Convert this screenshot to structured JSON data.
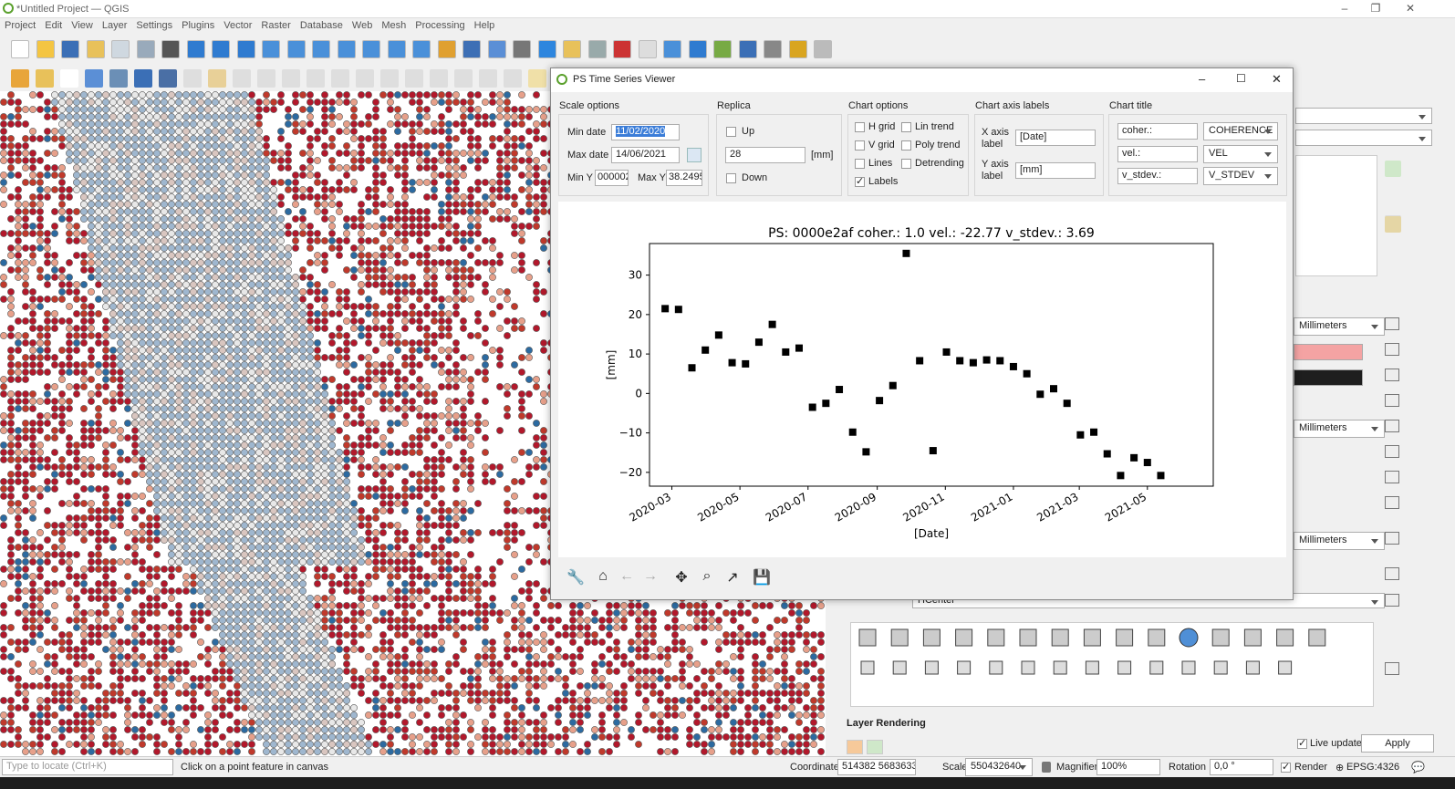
{
  "app": {
    "title": "*Untitled Project — QGIS"
  },
  "menu": [
    "Project",
    "Edit",
    "View",
    "Layer",
    "Settings",
    "Plugins",
    "Vector",
    "Raster",
    "Database",
    "Web",
    "Mesh",
    "Processing",
    "Help"
  ],
  "dialog": {
    "title": "PS Time Series Viewer",
    "scale_options": {
      "label": "Scale options",
      "min_date_label": "Min date",
      "min_date": "11/02/2020",
      "max_date_label": "Max date",
      "max_date": "14/06/2021",
      "min_y_label": "Min Y",
      "min_y": "000002",
      "max_y_label": "Max Y",
      "max_y": "38.2495"
    },
    "replica": {
      "label": "Replica",
      "up": "Up",
      "value": "28",
      "unit": "[mm]",
      "down": "Down"
    },
    "chart_options": {
      "label": "Chart options",
      "hgrid": "H grid",
      "vgrid": "V grid",
      "lines": "Lines",
      "labels": "Labels",
      "lin_trend": "Lin trend",
      "poly_trend": "Poly trend",
      "detrending": "Detrending"
    },
    "axis_labels": {
      "label": "Chart axis labels",
      "x_label": "X axis label",
      "x_value": "[Date]",
      "y_label": "Y axis label",
      "y_value": "[mm]"
    },
    "chart_title": {
      "label": "Chart title",
      "rows": [
        {
          "prefix": "coher.:",
          "field": "COHERENCE"
        },
        {
          "prefix": "vel.:",
          "field": "VEL"
        },
        {
          "prefix": "v_stdev.:",
          "field": "V_STDEV"
        }
      ]
    }
  },
  "chart_data": {
    "type": "scatter",
    "title": "PS: 0000e2af coher.: 1.0 vel.: -22.77 v_stdev.: 3.69",
    "xlabel": "[Date]",
    "ylabel": "[mm]",
    "xlim": [
      "2020-02-10",
      "2021-06-29"
    ],
    "ylim": [
      -23.5,
      38
    ],
    "xticks": [
      "2020-03",
      "2020-05",
      "2020-07",
      "2020-09",
      "2020-11",
      "2021-01",
      "2021-03",
      "2021-05"
    ],
    "yticks": [
      -20,
      -10,
      0,
      10,
      20,
      30
    ],
    "x": [
      "2020-02-24",
      "2020-03-07",
      "2020-03-19",
      "2020-03-31",
      "2020-04-12",
      "2020-04-24",
      "2020-05-06",
      "2020-05-18",
      "2020-05-30",
      "2020-06-11",
      "2020-06-23",
      "2020-07-05",
      "2020-07-17",
      "2020-07-29",
      "2020-08-10",
      "2020-08-22",
      "2020-09-03",
      "2020-09-15",
      "2020-09-27",
      "2020-10-09",
      "2020-10-21",
      "2020-11-02",
      "2020-11-14",
      "2020-11-26",
      "2020-12-08",
      "2020-12-20",
      "2021-01-01",
      "2021-01-13",
      "2021-01-25",
      "2021-02-06",
      "2021-02-18",
      "2021-03-02",
      "2021-03-14",
      "2021-03-26",
      "2021-04-07",
      "2021-04-19",
      "2021-05-01",
      "2021-05-13",
      "2021-05-25",
      "2021-06-06"
    ],
    "y": [
      21.5,
      21.3,
      6.5,
      11,
      14.8,
      7.8,
      7.5,
      13,
      17.5,
      10.5,
      11.5,
      -3.5,
      -2.5,
      1,
      -9.8,
      -14.8,
      -1.8,
      2,
      35.5,
      8.3,
      -14.5,
      10.5,
      8.3,
      7.8,
      8.5,
      8.3,
      6.8,
      5,
      -0.2,
      1.2,
      -2.5,
      -10.5,
      -9.8,
      -15.3,
      -20.8,
      -16.3,
      -17.5,
      -20.8
    ]
  },
  "map": {
    "colors": {
      "dark_red": "#b2182b",
      "mid_red": "#c0392b",
      "salmon": "#e7a08a",
      "light": "#d9c6c0",
      "grey_blue": "#9fb7cf",
      "blue": "#2c6aa0",
      "pale": "#e8e8e8"
    }
  },
  "right_panel": {
    "units": [
      "Millimeters",
      "Millimeters",
      "Millimeters"
    ],
    "hcenter": "HCenter",
    "layer_rendering": "Layer Rendering",
    "live_update": "Live update",
    "apply": "Apply"
  },
  "status": {
    "locate_placeholder": "Type to locate (Ctrl+K)",
    "message": "Click on a point feature in canvas",
    "coordinate_label": "Coordinate",
    "coordinate": "514382 5683633",
    "scale_label": "Scale",
    "scale": "550432640",
    "magnifier_label": "Magnifier",
    "magnifier": "100%",
    "rotation_label": "Rotation",
    "rotation": "0,0 °",
    "render": "Render",
    "crs": "EPSG:4326"
  }
}
